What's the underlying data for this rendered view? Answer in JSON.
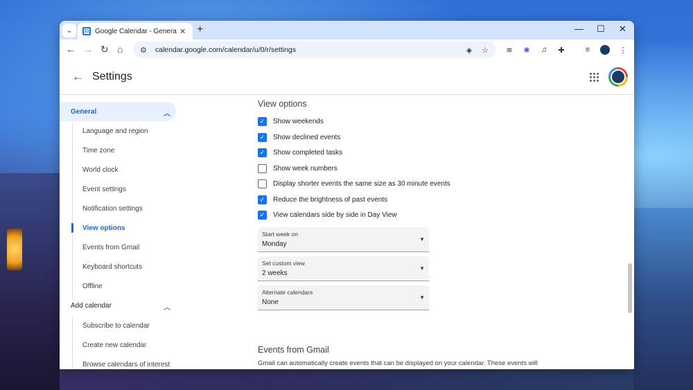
{
  "browser": {
    "tab_title": "Google Calendar - General setti",
    "favicon_text": "31",
    "url": "calendar.google.com/calendar/u/0/r/settings"
  },
  "app": {
    "title": "Settings"
  },
  "sidebar": {
    "general_label": "General",
    "general_items": [
      {
        "label": "Language and region"
      },
      {
        "label": "Time zone"
      },
      {
        "label": "World clock"
      },
      {
        "label": "Event settings"
      },
      {
        "label": "Notification settings"
      },
      {
        "label": "View options"
      },
      {
        "label": "Events from Gmail"
      },
      {
        "label": "Keyboard shortcuts"
      },
      {
        "label": "Offline"
      }
    ],
    "selected_item": "View options",
    "add_calendar_label": "Add calendar",
    "add_calendar_items": [
      {
        "label": "Subscribe to calendar"
      },
      {
        "label": "Create new calendar"
      },
      {
        "label": "Browse calendars of interest"
      }
    ]
  },
  "view_options": {
    "title": "View options",
    "checkboxes": [
      {
        "label": "Show weekends",
        "checked": true
      },
      {
        "label": "Show declined events",
        "checked": true
      },
      {
        "label": "Show completed tasks",
        "checked": true
      },
      {
        "label": "Show week numbers",
        "checked": false
      },
      {
        "label": "Display shorter events the same size as 30 minute events",
        "checked": false
      },
      {
        "label": "Reduce the brightness of past events",
        "checked": true
      },
      {
        "label": "View calendars side by side in Day View",
        "checked": true
      }
    ],
    "selects": [
      {
        "label": "Start week on",
        "value": "Monday"
      },
      {
        "label": "Set custom view",
        "value": "2 weeks"
      },
      {
        "label": "Alternate calendars",
        "value": "None"
      }
    ]
  },
  "events_from_gmail": {
    "title": "Events from Gmail",
    "description": "Gmail can automatically create events that can be displayed on your calendar. These events will"
  },
  "colors": {
    "accent": "#1a73e8",
    "selected_text": "#1967d2",
    "tabstrip": "#d3e3fd"
  }
}
